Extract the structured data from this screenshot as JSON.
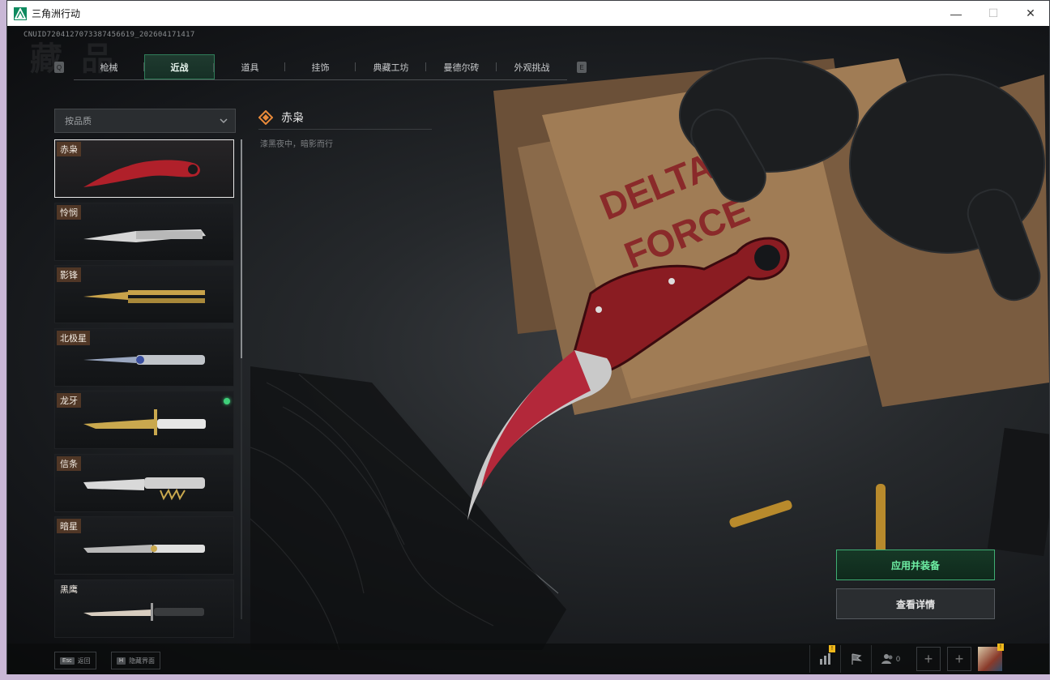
{
  "window": {
    "title": "三角洲行动",
    "minimize": "—",
    "maximize": "☐",
    "close": "✕"
  },
  "uid": "CNUID7204127073387456619_202604171417",
  "page_bg_title": "藏 品",
  "tabs": [
    {
      "label": "枪械",
      "active": false
    },
    {
      "label": "近战",
      "active": true
    },
    {
      "label": "道具",
      "active": false
    },
    {
      "label": "挂饰",
      "active": false
    },
    {
      "label": "典藏工坊",
      "active": false
    },
    {
      "label": "曼德尔砖",
      "active": false
    },
    {
      "label": "外观挑战",
      "active": false
    }
  ],
  "tab_keys": {
    "left": "Q",
    "right": "E"
  },
  "filter": {
    "value": "按品质"
  },
  "items": [
    {
      "name": "赤枭",
      "selected": true,
      "equipped": false,
      "color": "#b0202a"
    },
    {
      "name": "怜悯",
      "selected": false,
      "equipped": false,
      "color": "#d6d6d6"
    },
    {
      "name": "影锋",
      "selected": false,
      "equipped": false,
      "color": "#c8a24a"
    },
    {
      "name": "北极星",
      "selected": false,
      "equipped": false,
      "color": "#9aa7c0"
    },
    {
      "name": "龙牙",
      "selected": false,
      "equipped": true,
      "color": "#c9a84e"
    },
    {
      "name": "信条",
      "selected": false,
      "equipped": false,
      "color": "#d9d9d9"
    },
    {
      "name": "暗星",
      "selected": false,
      "equipped": false,
      "color": "#b9b9b9"
    },
    {
      "name": "黑鹰",
      "selected": false,
      "equipped": false,
      "color": "#d8cdbf"
    }
  ],
  "detail": {
    "name": "赤枭",
    "description": "漆黑夜中，暗影而行",
    "quality_color": "#e88a3a"
  },
  "actions": {
    "apply_equip": "应用并装备",
    "view_detail": "查看详情"
  },
  "bottom_hints": [
    {
      "key": "Esc",
      "label": "返回"
    },
    {
      "key": "H",
      "label": "隐藏界面"
    }
  ],
  "bottom_bar": {
    "friend_count": "0",
    "badge": "!",
    "plus": "+"
  },
  "colors": {
    "accent_green": "#3fae73",
    "tab_active_bg": "#1f3a2f",
    "badge_yellow": "#f0b81a"
  }
}
